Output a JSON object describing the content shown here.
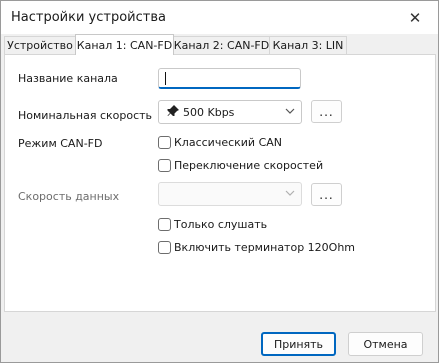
{
  "window": {
    "title": "Настройки устройства",
    "close_glyph": "✕"
  },
  "tabs": [
    {
      "label": "Устройство",
      "active": false
    },
    {
      "label": "Канал 1: CAN-FD",
      "active": true
    },
    {
      "label": "Канал 2: CAN-FD",
      "active": false
    },
    {
      "label": "Канал 3: LIN",
      "active": false
    }
  ],
  "form": {
    "channel_name_label": "Название канала",
    "channel_name_value": "",
    "nominal_speed_label": "Номинальная скорость",
    "nominal_speed_value": "500 Kbps",
    "nominal_speed_icon": "pin-icon",
    "more_label": "...",
    "canfd_mode_label": "Режим CAN-FD",
    "classic_can_label": "Классический CAN",
    "classic_can_checked": false,
    "bitrate_switch_label": "Переключение скоростей",
    "bitrate_switch_checked": false,
    "data_speed_label": "Скорость данных",
    "data_speed_value": "",
    "data_speed_more_label": "...",
    "listen_only_label": "Только слушать",
    "listen_only_checked": false,
    "terminator_label": "Включить терминатор 120Ohm",
    "terminator_checked": false
  },
  "footer": {
    "accept_label": "Принять",
    "cancel_label": "Отмена"
  },
  "colors": {
    "accent": "#0067c0",
    "window_bg": "#f0f0f0",
    "panel_bg": "#ffffff"
  }
}
